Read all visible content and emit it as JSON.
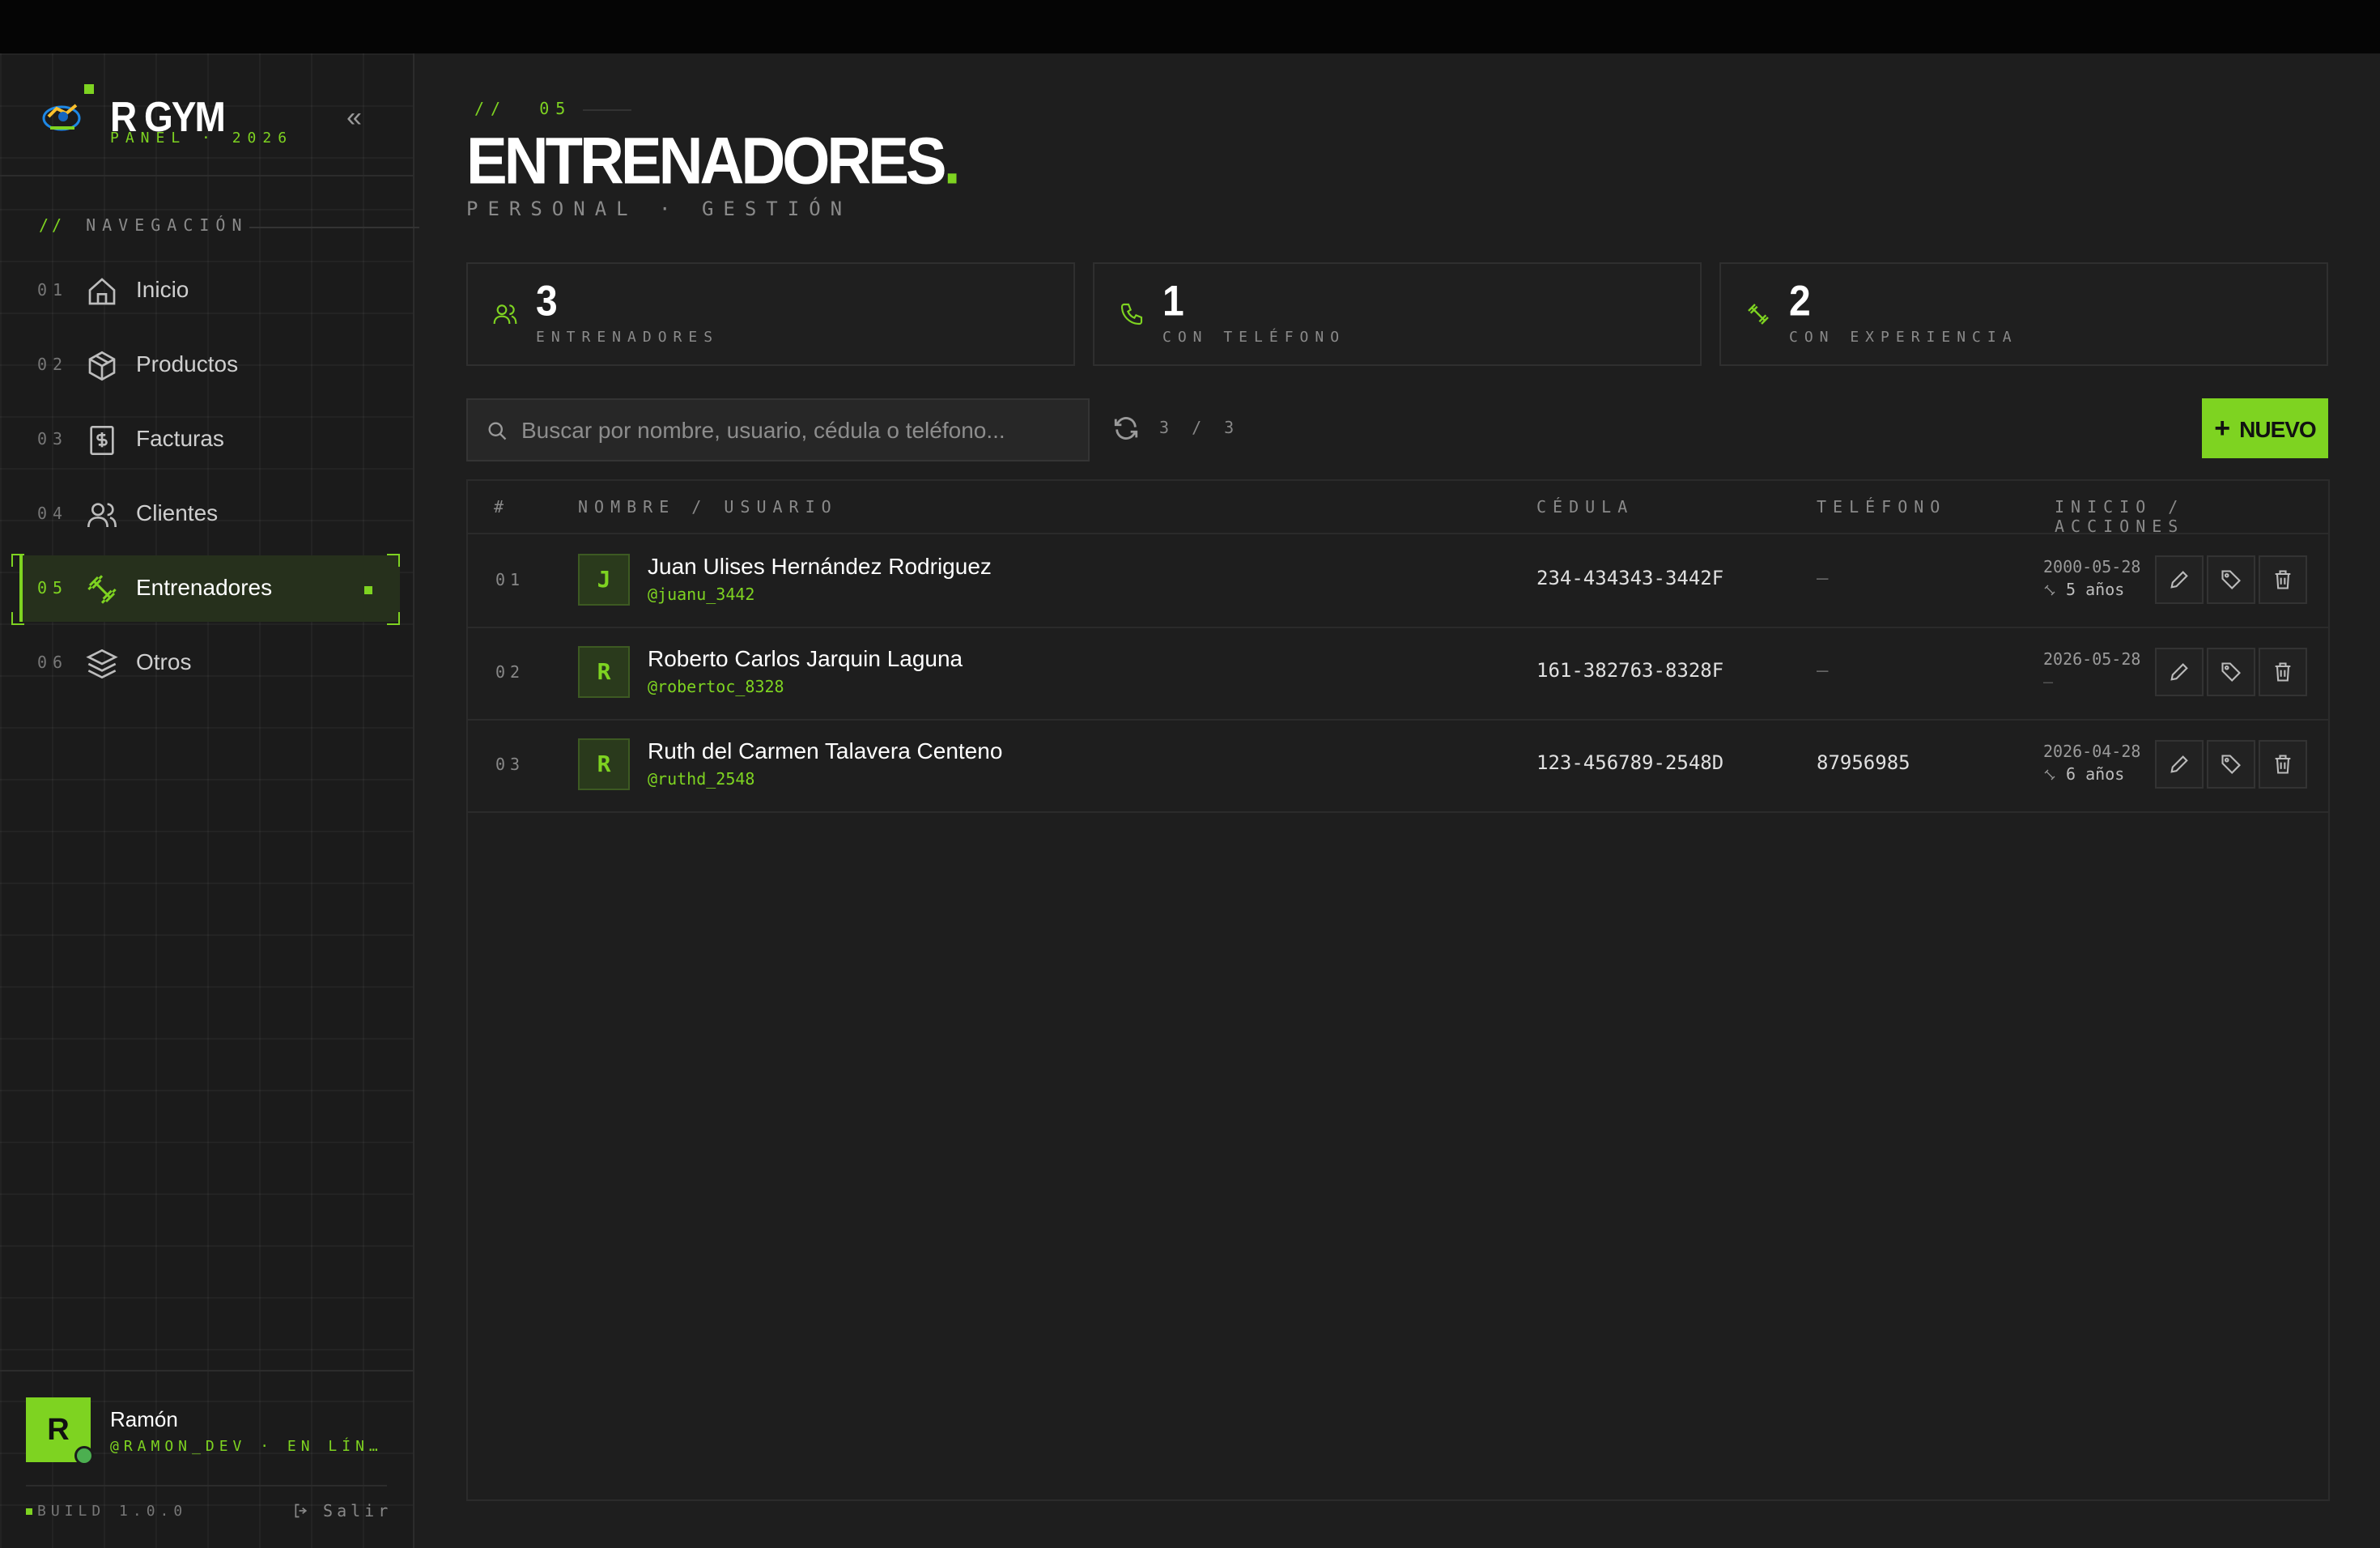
{
  "brand": {
    "title": "R GYM",
    "subtitle": "PANEL · 2026"
  },
  "sidebar": {
    "section_title": "NAVEGACIÓN",
    "section_prefix": "//",
    "items": [
      {
        "num": "01",
        "label": "Inicio",
        "icon": "home-icon",
        "active": false
      },
      {
        "num": "02",
        "label": "Productos",
        "icon": "box-icon",
        "active": false
      },
      {
        "num": "03",
        "label": "Facturas",
        "icon": "invoice-icon",
        "active": false
      },
      {
        "num": "04",
        "label": "Clientes",
        "icon": "users-icon",
        "active": false
      },
      {
        "num": "05",
        "label": "Entrenadores",
        "icon": "dumbbell-icon",
        "active": true
      },
      {
        "num": "06",
        "label": "Otros",
        "icon": "layers-icon",
        "active": false
      }
    ],
    "user": {
      "initial": "R",
      "name": "Ramón",
      "handle": "@RAMON_DEV · EN LÍN…"
    },
    "build": "BUILD 1.0.0",
    "logout": "Salir"
  },
  "page": {
    "prefix": "//",
    "number": "05",
    "title": "ENTRENADORES",
    "title_suffix": ".",
    "subtitle": "PERSONAL · GESTIÓN"
  },
  "stats": [
    {
      "value": "3",
      "label": "ENTRENADORES",
      "icon": "users-icon"
    },
    {
      "value": "1",
      "label": "CON TELÉFONO",
      "icon": "phone-icon"
    },
    {
      "value": "2",
      "label": "CON EXPERIENCIA",
      "icon": "dumbbell-icon"
    }
  ],
  "toolbar": {
    "search_placeholder": "Buscar por nombre, usuario, cédula o teléfono...",
    "count": "3 / 3",
    "new_label": "NUEVO"
  },
  "table": {
    "headers": {
      "idx": "#",
      "name": "NOMBRE / USUARIO",
      "ced": "CÉDULA",
      "tel": "TELÉFONO",
      "actions": "INICIO / ACCIONES"
    },
    "rows": [
      {
        "idx": "01",
        "initial": "J",
        "name": "Juan Ulises Hernández Rodriguez",
        "user": "@juanu_3442",
        "cedula": "234-434343-3442F",
        "telefono": "—",
        "inicio": "2000-05-28",
        "experiencia": "5 años"
      },
      {
        "idx": "02",
        "initial": "R",
        "name": "Roberto Carlos Jarquin Laguna",
        "user": "@robertoc_8328",
        "cedula": "161-382763-8328F",
        "telefono": "—",
        "inicio": "2026-05-28",
        "experiencia": "—"
      },
      {
        "idx": "03",
        "initial": "R",
        "name": "Ruth del Carmen Talavera Centeno",
        "user": "@ruthd_2548",
        "cedula": "123-456789-2548D",
        "telefono": "87956985",
        "inicio": "2026-04-28",
        "experiencia": "6 años"
      }
    ]
  },
  "colors": {
    "accent": "#7ed321",
    "background": "#1e1e1e",
    "sidebar": "#1b1b1b"
  }
}
